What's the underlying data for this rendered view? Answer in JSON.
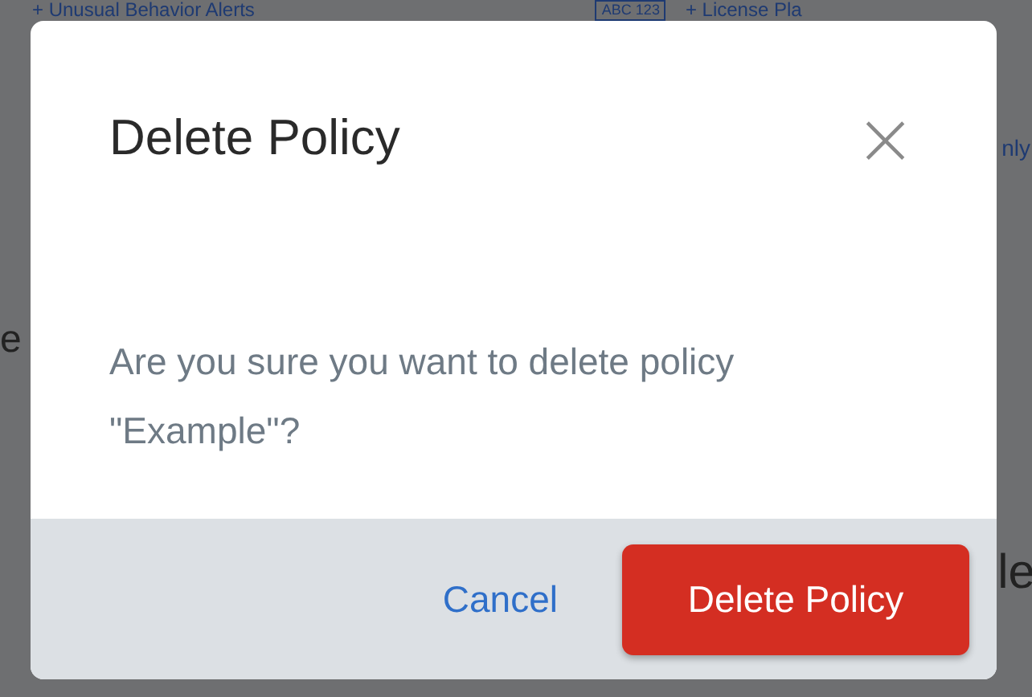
{
  "background": {
    "top_links": [
      "+ Unusual Behavior Alerts",
      "+ License Pla"
    ],
    "plate_badge": "ABC 123",
    "fragments": [
      "nly",
      "e",
      "le"
    ]
  },
  "dialog": {
    "title": "Delete Policy",
    "close": "×",
    "message": "Are you sure you want to delete policy \"Example\"?",
    "buttons": [
      {
        "label": "Cancel",
        "kind": "link"
      },
      {
        "label": "Delete Policy",
        "kind": "danger"
      }
    ]
  }
}
